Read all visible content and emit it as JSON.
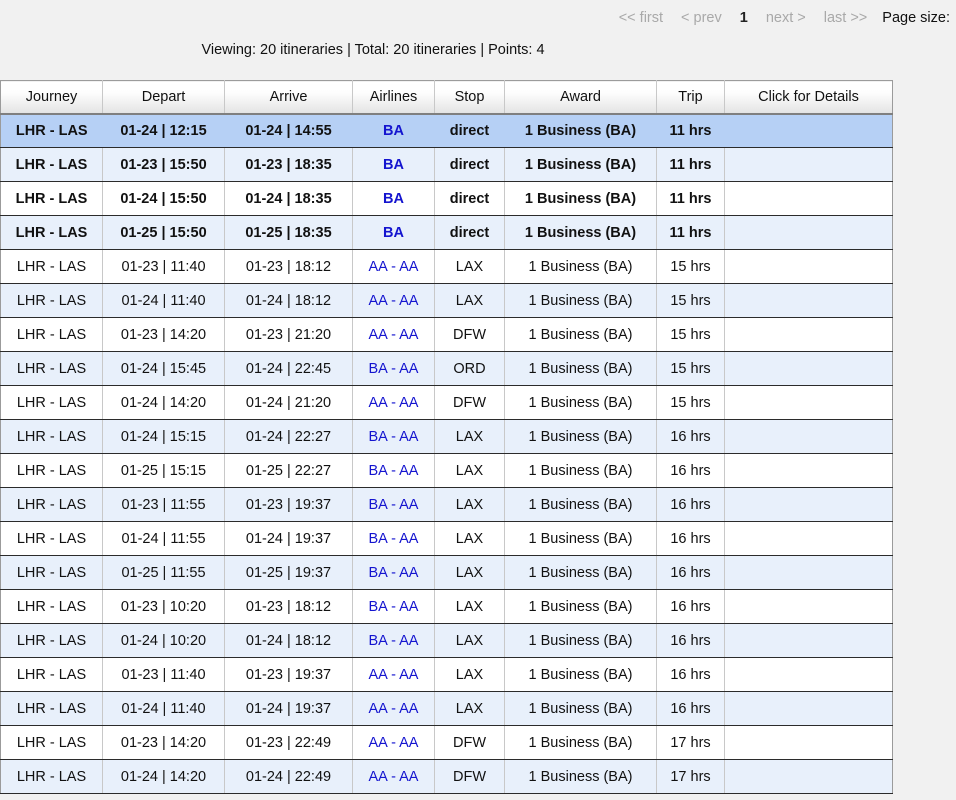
{
  "pager": {
    "first": "<< first",
    "prev": "< prev",
    "current": "1",
    "next": "next >",
    "last": "last >>",
    "page_size_label": "Page size:"
  },
  "summary": {
    "text": "Viewing: 20 itineraries | Total: 20 itineraries | Points: 4"
  },
  "table": {
    "columns": [
      "Journey",
      "Depart",
      "Arrive",
      "Airlines",
      "Stop",
      "Award",
      "Trip",
      "Click for Details"
    ],
    "rows": [
      {
        "journey": "LHR - LAS",
        "depart": "01-24 | 12:15",
        "arrive": "01-24 | 14:55",
        "airlines": "BA",
        "stop": "direct",
        "award": "1 Business (BA)",
        "trip": "11 hrs",
        "details": "",
        "style": "selected",
        "bold": true
      },
      {
        "journey": "LHR - LAS",
        "depart": "01-23 | 15:50",
        "arrive": "01-23 | 18:35",
        "airlines": "BA",
        "stop": "direct",
        "award": "1 Business (BA)",
        "trip": "11 hrs",
        "details": "",
        "style": "alt",
        "bold": true
      },
      {
        "journey": "LHR - LAS",
        "depart": "01-24 | 15:50",
        "arrive": "01-24 | 18:35",
        "airlines": "BA",
        "stop": "direct",
        "award": "1 Business (BA)",
        "trip": "11 hrs",
        "details": "",
        "style": "white",
        "bold": true
      },
      {
        "journey": "LHR - LAS",
        "depart": "01-25 | 15:50",
        "arrive": "01-25 | 18:35",
        "airlines": "BA",
        "stop": "direct",
        "award": "1 Business (BA)",
        "trip": "11 hrs",
        "details": "",
        "style": "alt",
        "bold": true
      },
      {
        "journey": "LHR - LAS",
        "depart": "01-23 | 11:40",
        "arrive": "01-23 | 18:12",
        "airlines": "AA - AA",
        "stop": "LAX",
        "award": "1 Business (BA)",
        "trip": "15 hrs",
        "details": "",
        "style": "white",
        "bold": false
      },
      {
        "journey": "LHR - LAS",
        "depart": "01-24 | 11:40",
        "arrive": "01-24 | 18:12",
        "airlines": "AA - AA",
        "stop": "LAX",
        "award": "1 Business (BA)",
        "trip": "15 hrs",
        "details": "",
        "style": "alt",
        "bold": false
      },
      {
        "journey": "LHR - LAS",
        "depart": "01-23 | 14:20",
        "arrive": "01-23 | 21:20",
        "airlines": "AA - AA",
        "stop": "DFW",
        "award": "1 Business (BA)",
        "trip": "15 hrs",
        "details": "",
        "style": "white",
        "bold": false
      },
      {
        "journey": "LHR - LAS",
        "depart": "01-24 | 15:45",
        "arrive": "01-24 | 22:45",
        "airlines": "BA - AA",
        "stop": "ORD",
        "award": "1 Business (BA)",
        "trip": "15 hrs",
        "details": "",
        "style": "alt",
        "bold": false
      },
      {
        "journey": "LHR - LAS",
        "depart": "01-24 | 14:20",
        "arrive": "01-24 | 21:20",
        "airlines": "AA - AA",
        "stop": "DFW",
        "award": "1 Business (BA)",
        "trip": "15 hrs",
        "details": "",
        "style": "white",
        "bold": false
      },
      {
        "journey": "LHR - LAS",
        "depart": "01-24 | 15:15",
        "arrive": "01-24 | 22:27",
        "airlines": "BA - AA",
        "stop": "LAX",
        "award": "1 Business (BA)",
        "trip": "16 hrs",
        "details": "",
        "style": "alt",
        "bold": false
      },
      {
        "journey": "LHR - LAS",
        "depart": "01-25 | 15:15",
        "arrive": "01-25 | 22:27",
        "airlines": "BA - AA",
        "stop": "LAX",
        "award": "1 Business (BA)",
        "trip": "16 hrs",
        "details": "",
        "style": "white",
        "bold": false
      },
      {
        "journey": "LHR - LAS",
        "depart": "01-23 | 11:55",
        "arrive": "01-23 | 19:37",
        "airlines": "BA - AA",
        "stop": "LAX",
        "award": "1 Business (BA)",
        "trip": "16 hrs",
        "details": "",
        "style": "alt",
        "bold": false
      },
      {
        "journey": "LHR - LAS",
        "depart": "01-24 | 11:55",
        "arrive": "01-24 | 19:37",
        "airlines": "BA - AA",
        "stop": "LAX",
        "award": "1 Business (BA)",
        "trip": "16 hrs",
        "details": "",
        "style": "white",
        "bold": false
      },
      {
        "journey": "LHR - LAS",
        "depart": "01-25 | 11:55",
        "arrive": "01-25 | 19:37",
        "airlines": "BA - AA",
        "stop": "LAX",
        "award": "1 Business (BA)",
        "trip": "16 hrs",
        "details": "",
        "style": "alt",
        "bold": false
      },
      {
        "journey": "LHR - LAS",
        "depart": "01-23 | 10:20",
        "arrive": "01-23 | 18:12",
        "airlines": "BA - AA",
        "stop": "LAX",
        "award": "1 Business (BA)",
        "trip": "16 hrs",
        "details": "",
        "style": "white",
        "bold": false
      },
      {
        "journey": "LHR - LAS",
        "depart": "01-24 | 10:20",
        "arrive": "01-24 | 18:12",
        "airlines": "BA - AA",
        "stop": "LAX",
        "award": "1 Business (BA)",
        "trip": "16 hrs",
        "details": "",
        "style": "alt",
        "bold": false
      },
      {
        "journey": "LHR - LAS",
        "depart": "01-23 | 11:40",
        "arrive": "01-23 | 19:37",
        "airlines": "AA - AA",
        "stop": "LAX",
        "award": "1 Business (BA)",
        "trip": "16 hrs",
        "details": "",
        "style": "white",
        "bold": false
      },
      {
        "journey": "LHR - LAS",
        "depart": "01-24 | 11:40",
        "arrive": "01-24 | 19:37",
        "airlines": "AA - AA",
        "stop": "LAX",
        "award": "1 Business (BA)",
        "trip": "16 hrs",
        "details": "",
        "style": "alt",
        "bold": false
      },
      {
        "journey": "LHR - LAS",
        "depart": "01-23 | 14:20",
        "arrive": "01-23 | 22:49",
        "airlines": "AA - AA",
        "stop": "DFW",
        "award": "1 Business (BA)",
        "trip": "17 hrs",
        "details": "",
        "style": "white",
        "bold": false
      },
      {
        "journey": "LHR - LAS",
        "depart": "01-24 | 14:20",
        "arrive": "01-24 | 22:49",
        "airlines": "AA - AA",
        "stop": "DFW",
        "award": "1 Business (BA)",
        "trip": "17 hrs",
        "details": "",
        "style": "alt",
        "bold": false
      }
    ]
  },
  "colors": {
    "selected_row": "#b6d0f5",
    "alt_row": "#e8f0fb",
    "airline_link": "#1414cf",
    "page_background": "#f1f1f1",
    "disabled_link": "#a9a9a9"
  }
}
